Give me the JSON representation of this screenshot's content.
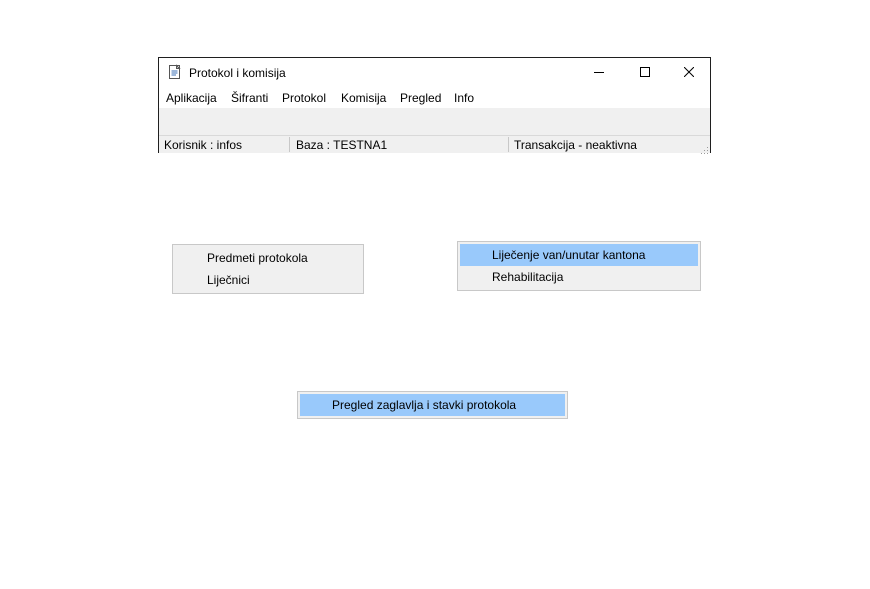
{
  "window": {
    "title": "Protokol i komisija",
    "menu": [
      "Aplikacija",
      "Šifranti",
      "Protokol",
      "Komisija",
      "Pregled",
      "Info"
    ],
    "status": {
      "user": "Korisnik : infos",
      "database": "Baza : TESTNA1",
      "transaction": "Transakcija - neaktivna"
    },
    "icons": {
      "app": "app-icon",
      "minimize": "minimize-icon",
      "maximize": "maximize-icon",
      "close": "close-icon"
    }
  },
  "popups": {
    "sifranti": {
      "items": [
        "Predmeti protokola",
        "Liječnici"
      ]
    },
    "komisija": {
      "items": [
        "Liječenje van/unutar kantona",
        "Rehabilitacija"
      ],
      "selected": "Liječenje van/unutar kantona"
    },
    "pregled": {
      "items": [
        "Pregled zaglavlja i stavki protokola"
      ],
      "selected": "Pregled zaglavlja i stavki protokola"
    }
  },
  "colors": {
    "selection": "#99c9fb",
    "menu_bg": "#f0f0f0",
    "border": "#c8c8c8"
  }
}
